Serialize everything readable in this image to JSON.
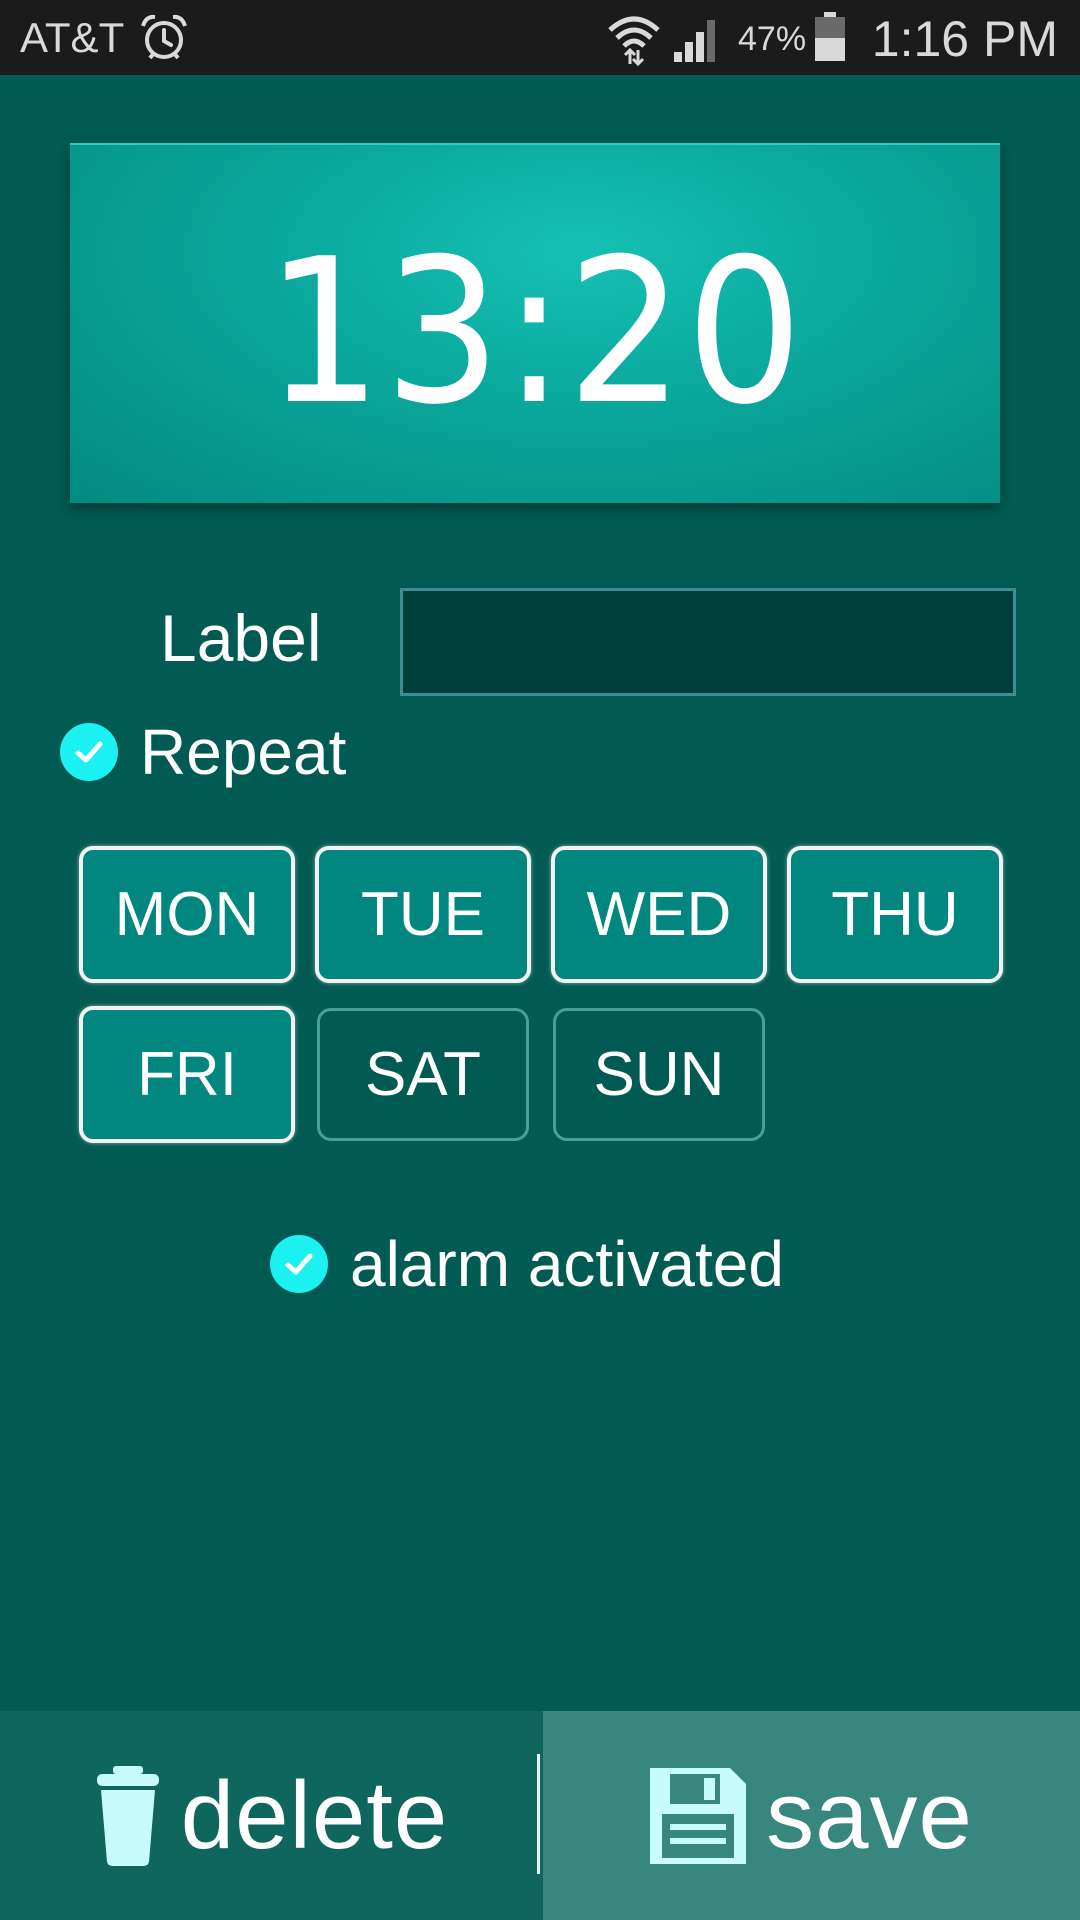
{
  "status_bar": {
    "carrier": "AT&T",
    "battery_percent": "47%",
    "time": "1:16 PM",
    "icons": [
      "alarm-clock-icon",
      "wifi-icon",
      "signal-icon",
      "battery-icon"
    ]
  },
  "alarm": {
    "time": "13:20"
  },
  "label": {
    "title": "Label",
    "value": "",
    "placeholder": ""
  },
  "repeat": {
    "label": "Repeat",
    "checked": true
  },
  "days": [
    {
      "label": "MON",
      "selected": true
    },
    {
      "label": "TUE",
      "selected": true
    },
    {
      "label": "WED",
      "selected": true
    },
    {
      "label": "THU",
      "selected": true
    },
    {
      "label": "FRI",
      "selected": true
    },
    {
      "label": "SAT",
      "selected": false
    },
    {
      "label": "SUN",
      "selected": false
    }
  ],
  "activated": {
    "label": "alarm activated",
    "checked": true
  },
  "actions": {
    "delete_label": "delete",
    "save_label": "save"
  },
  "colors": {
    "background": "#015b52",
    "accent_check": "#1cf1f2",
    "card": "#0aa69b"
  }
}
